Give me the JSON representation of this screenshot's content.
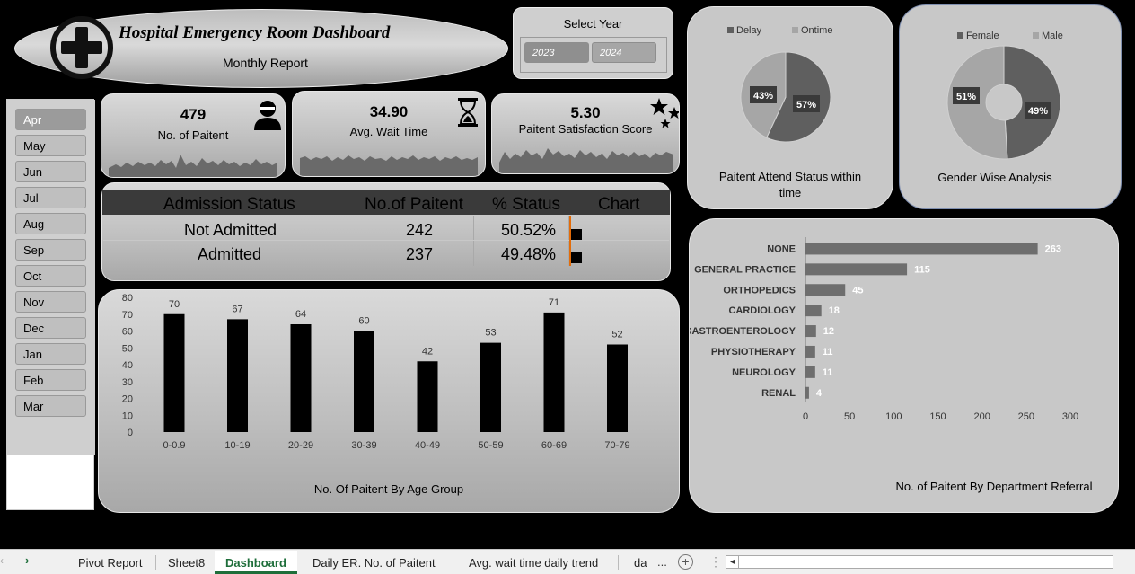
{
  "header": {
    "title": "Hospital Emergency Room Dashboard",
    "subtitle": "Monthly Report",
    "logo": "medical-cross-icon"
  },
  "year_slicer": {
    "title": "Select Year",
    "options": [
      "2023",
      "2024"
    ]
  },
  "month_slicer": {
    "months": [
      "Apr",
      "May",
      "Jun",
      "Jul",
      "Aug",
      "Sep",
      "Oct",
      "Nov",
      "Dec",
      "Jan",
      "Feb",
      "Mar"
    ],
    "selected": "Apr"
  },
  "kpis": {
    "patients": {
      "value": "479",
      "label": "No. of Paitent",
      "icon": "patient-icon"
    },
    "wait": {
      "value": "34.90",
      "label": "Avg. Wait Time",
      "icon": "hourglass-icon"
    },
    "satisfaction": {
      "value": "5.30",
      "label": "Paitent Satisfaction Score",
      "icon": "stars-icon"
    }
  },
  "admission": {
    "headers": [
      "Admission Status",
      "No.of Paitent",
      "% Status",
      "Chart"
    ],
    "rows": [
      {
        "status": "Not Admitted",
        "count": "242",
        "pct": "50.52%",
        "bar": 0.5052
      },
      {
        "status": "Admitted",
        "count": "237",
        "pct": "49.48%",
        "bar": 0.4948
      }
    ]
  },
  "colors": {
    "dark": "#5f5f5f",
    "light": "#a6a6a6",
    "bar": "#000000",
    "dept_bar": "#6e6e6e",
    "accent": "#e36c09"
  },
  "chart_data": [
    {
      "id": "attend",
      "type": "pie",
      "title": "Paitent Attend Status within time",
      "categories": [
        "Delay",
        "Ontime"
      ],
      "values": [
        57,
        43
      ],
      "labels": [
        "57%",
        "43%"
      ],
      "legend": "top"
    },
    {
      "id": "gender",
      "type": "pie",
      "title": "Gender Wise Analysis",
      "categories": [
        "Female",
        "Male"
      ],
      "values": [
        49,
        51
      ],
      "labels": [
        "49%",
        "51%"
      ],
      "legend": "top"
    },
    {
      "id": "age",
      "type": "bar",
      "title": "No. Of Paitent By Age Group",
      "categories": [
        "0-0.9",
        "10-19",
        "20-29",
        "30-39",
        "40-49",
        "50-59",
        "60-69",
        "70-79"
      ],
      "values": [
        70,
        67,
        64,
        60,
        42,
        53,
        71,
        52
      ],
      "ylim": [
        0,
        80
      ],
      "yticks": [
        0,
        10,
        20,
        30,
        40,
        50,
        60,
        70,
        80
      ]
    },
    {
      "id": "dept",
      "type": "bar",
      "orientation": "horizontal",
      "title": "No. of Paitent By Department Referral",
      "categories": [
        "NONE",
        "GENERAL PRACTICE",
        "ORTHOPEDICS",
        "CARDIOLOGY",
        "GASTROENTEROLOGY",
        "PHYSIOTHERAPY",
        "NEUROLOGY",
        "RENAL"
      ],
      "values": [
        263,
        115,
        45,
        18,
        12,
        11,
        11,
        4
      ],
      "xlim": [
        0,
        300
      ],
      "xticks": [
        0,
        50,
        100,
        150,
        200,
        250,
        300
      ]
    }
  ],
  "sheets": {
    "tabs": [
      "Pivot Report",
      "Sheet8",
      "Dashboard",
      "Daily ER. No. of Paitent",
      "Avg. wait time daily trend",
      "da"
    ],
    "active": "Dashboard",
    "more": "..."
  }
}
